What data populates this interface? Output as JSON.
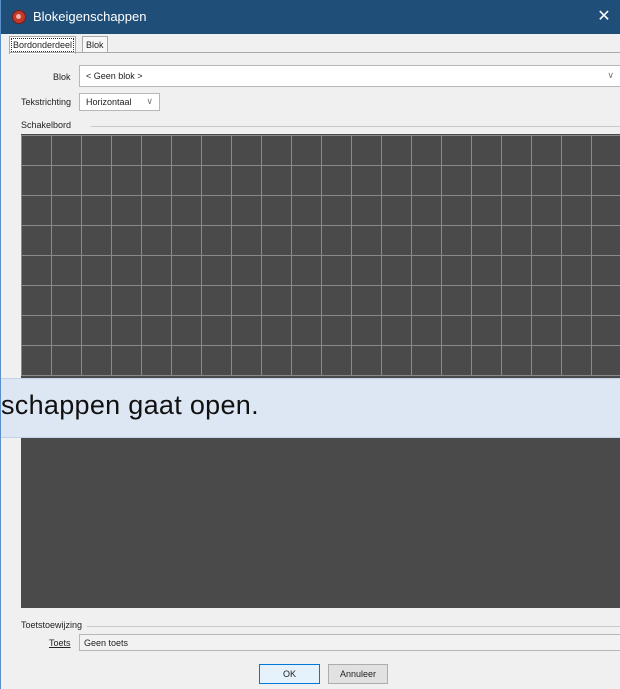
{
  "window": {
    "title": "Blokeigenschappen",
    "close_glyph": "✕"
  },
  "tabs": [
    {
      "label": "Bordonderdeel",
      "active": true
    },
    {
      "label": "Blok",
      "active": false
    }
  ],
  "form": {
    "blok_label": "Blok",
    "blok_value": "< Geen blok >",
    "tekstrichting_label": "Tekstrichting",
    "tekstrichting_value": "Horizontaal"
  },
  "schakelbord": {
    "label": "Schakelbord",
    "columns": 20,
    "rows": 8
  },
  "banner_text": "schappen gaat open.",
  "toetstoewijzing": {
    "label": "Toetstoewijzing",
    "toets_label": "Toets",
    "toets_value": "Geen toets"
  },
  "buttons": {
    "ok": "OK",
    "cancel": "Annuleer"
  },
  "icons": {
    "app": "app-logo-icon",
    "close": "close-icon",
    "chevron": "chevron-down-icon"
  },
  "colors": {
    "titlebar": "#1f4e79",
    "board": "#4a4a4a",
    "grid_line": "#8a8a8a",
    "banner": "#dde7f3"
  }
}
